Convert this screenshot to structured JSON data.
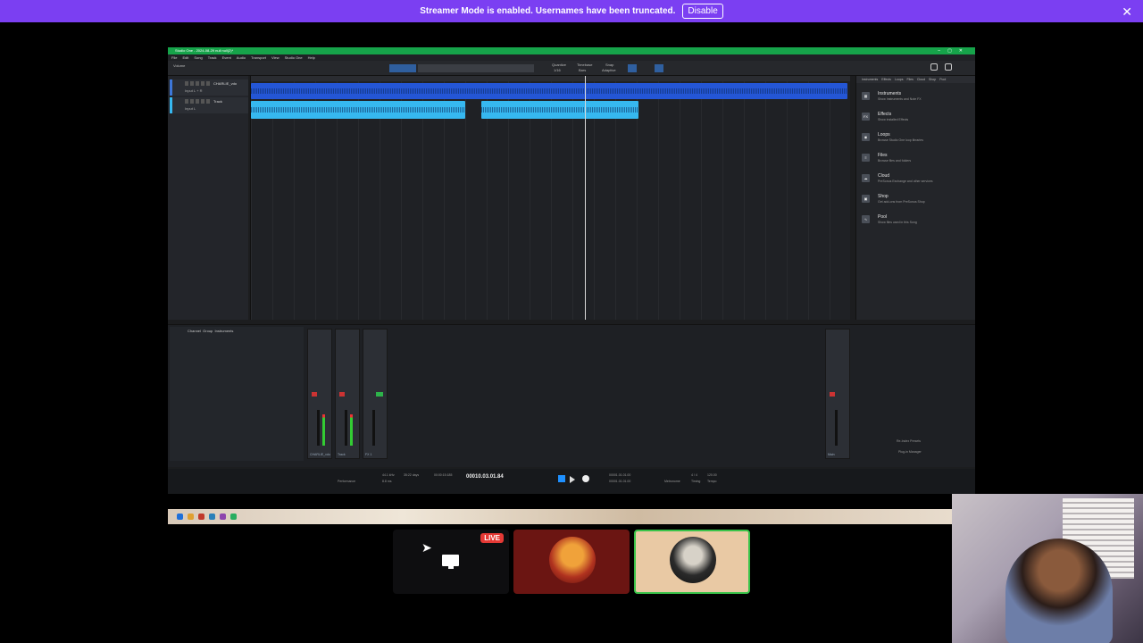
{
  "banner": {
    "message": "Streamer Mode is enabled. Usernames have been truncated.",
    "disable_label": "Disable",
    "close_glyph": "✕"
  },
  "daw": {
    "title": "Studio One - 2024-08-29 null null(2)*",
    "menus": [
      "File",
      "Edit",
      "Song",
      "Track",
      "Event",
      "Audio",
      "Transport",
      "View",
      "Studio One",
      "Help"
    ],
    "toolbar": {
      "song_name": "Volume",
      "quantize_label": "Quantize",
      "quantize_value": "1/16",
      "timebase_label": "Timebase",
      "timebase_value": "Bars",
      "snap_label": "Snap",
      "snap_value": "Adaptive"
    },
    "tracks": [
      {
        "name": "CHARLIE_vdo",
        "sub": "Input L + R"
      },
      {
        "name": "Track",
        "sub": "Input L"
      }
    ],
    "browser": {
      "tabs": [
        "Instruments",
        "Effects",
        "Loops",
        "Files",
        "Cloud",
        "Shop",
        "Pool"
      ],
      "items": [
        {
          "icon": "instruments-icon",
          "glyph": "▦",
          "title": "Instruments",
          "desc": "Show Instruments and Note FX"
        },
        {
          "icon": "effects-icon",
          "glyph": "FX",
          "title": "Effects",
          "desc": "Show installed Effects"
        },
        {
          "icon": "loops-icon",
          "glyph": "◉",
          "title": "Loops",
          "desc": "Browse Studio One loop libraries"
        },
        {
          "icon": "files-icon",
          "glyph": "≡",
          "title": "Files",
          "desc": "Browse files and folders"
        },
        {
          "icon": "cloud-icon",
          "glyph": "☁",
          "title": "Cloud",
          "desc": "PreSonus Exchange and other services"
        },
        {
          "icon": "shop-icon",
          "glyph": "▣",
          "title": "Shop",
          "desc": "Get add-ons from PreSonus Shop"
        },
        {
          "icon": "pool-icon",
          "glyph": "∿",
          "title": "Pool",
          "desc": "Show files used in this Song"
        }
      ],
      "footer_links": [
        "Re-Index Presets",
        "Plug-in Manager"
      ]
    },
    "console": {
      "tabs": [
        "Channel",
        "Group",
        "Instruments"
      ],
      "channels": [
        "CHARLIE_vdo",
        "Track",
        "FX 1"
      ],
      "inputs": [
        "Input L + R",
        "Input L",
        "Main"
      ],
      "main_label": "Main"
    },
    "transport": {
      "sample_rate": "44.1 kHz",
      "latency": "8.8 ms",
      "record_max": "35:22 days",
      "time_label": "00:00:15:185",
      "bars": "00010.03.01.84",
      "loop_start": "00001.01.01.00",
      "loop_end": "00001.01.01.00",
      "time_sig": "4 / 4",
      "tempo": "120.00",
      "performance_label": "Performance",
      "metronome_label": "Metronome",
      "timing_label": "Timing",
      "tempo_label": "Tempo"
    }
  },
  "call": {
    "live_label": "LIVE",
    "tiles": [
      {
        "type": "screen-share",
        "icon": "screen-share-icon"
      },
      {
        "type": "participant",
        "icon": "avatar"
      },
      {
        "type": "participant-speaking",
        "icon": "avatar"
      }
    ]
  },
  "colors": {
    "banner": "#7b3ff2",
    "titlebar": "#16a34a",
    "track_blue": "#3d77d9",
    "clip_cyan": "#36b8f0",
    "speaking_border": "#3ac44a",
    "live_red": "#e53935"
  }
}
